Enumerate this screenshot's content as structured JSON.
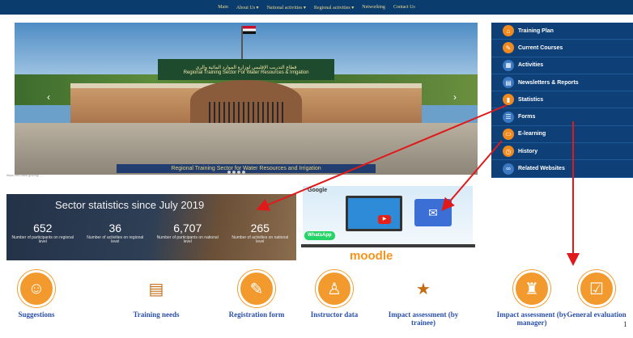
{
  "nav": {
    "items": [
      "Main",
      "About Us ▾",
      "National activities ▾",
      "Regional activities ▾",
      "Networking",
      "Contact Us"
    ]
  },
  "hero": {
    "sign_ar": "قطاع التدريب الإقليمي لوزارة الموارد المائية والري",
    "sign_en": "Regional Training Sector For Water Resources & Irrigation",
    "caption": "Regional Training Sector for Water Resources and Irrigation",
    "prev": "‹",
    "next": "›",
    "url": "https://rtc.mwri.gov.eg/ ..."
  },
  "sidebar": {
    "items": [
      {
        "label": "Training Plan",
        "icon": "org-chart-icon"
      },
      {
        "label": "Current Courses",
        "icon": "courses-icon"
      },
      {
        "label": "Activities",
        "icon": "calendar-icon"
      },
      {
        "label": "Newsletters & Reports",
        "icon": "newsletter-icon"
      },
      {
        "label": "Statistics",
        "icon": "statistics-icon"
      },
      {
        "label": "Forms",
        "icon": "forms-icon"
      },
      {
        "label": "E-learning",
        "icon": "elearning-icon"
      },
      {
        "label": "History",
        "icon": "history-icon"
      },
      {
        "label": "Related Websites",
        "icon": "link-icon"
      }
    ]
  },
  "stats": {
    "title": "Sector statistics since July 2019",
    "items": [
      {
        "value": "652",
        "label": "Number of participants on regional level"
      },
      {
        "value": "36",
        "label": "Number of activities on regional level"
      },
      {
        "value": "6,707",
        "label": "Number of participants on national level"
      },
      {
        "value": "265",
        "label": "Number of activities on national level"
      }
    ]
  },
  "promo": {
    "brand": "Google",
    "whatsapp": "WhatsApp",
    "moodle": "moodle"
  },
  "bottom": {
    "items": [
      {
        "label": "Suggestions",
        "icon": "suggestions-icon"
      },
      {
        "label": "Training needs",
        "icon": "training-needs-icon"
      },
      {
        "label": "Registration form",
        "icon": "registration-form-icon"
      },
      {
        "label": "Instructor data",
        "icon": "instructor-icon"
      },
      {
        "label": "Impact assessment (by trainee)",
        "icon": "trainee-assessment-icon"
      },
      {
        "label": "Impact assessment (by manager)",
        "icon": "manager-assessment-icon"
      },
      {
        "label": "General evaluation",
        "icon": "evaluation-icon"
      }
    ]
  },
  "page_number": "1",
  "colors": {
    "nav_bg": "#0b3c6e",
    "sidebar_bg": "#0e3f77",
    "accent_orange": "#f39a2e",
    "arrow_red": "#e01a1a",
    "caption_blue": "#2a4fa8"
  }
}
